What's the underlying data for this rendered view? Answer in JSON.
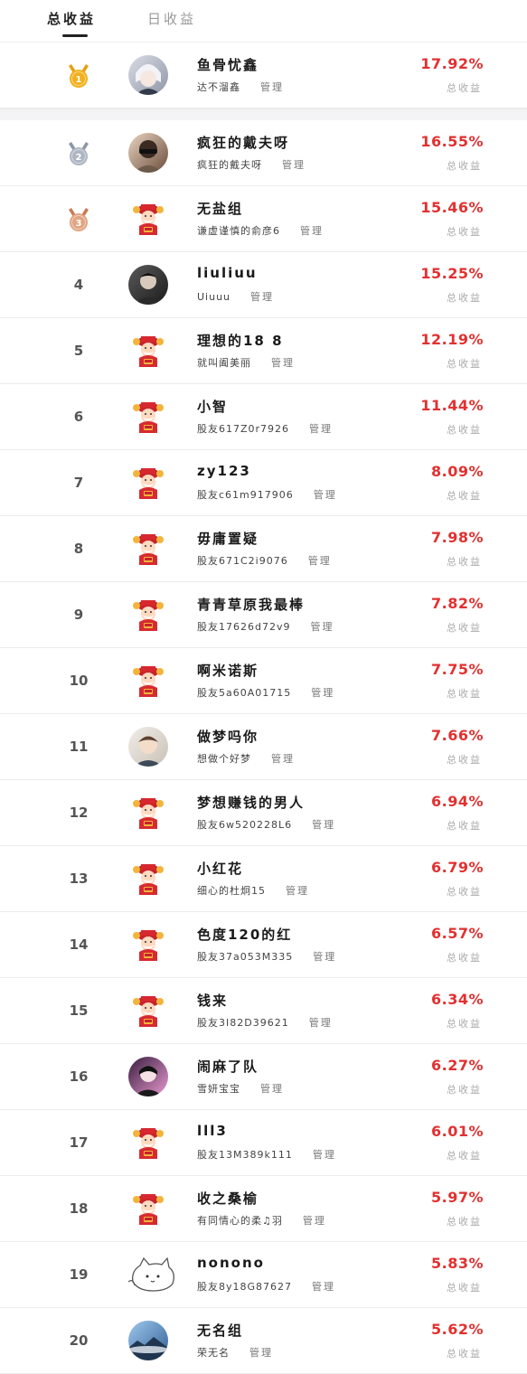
{
  "tabs": {
    "total": "总收益",
    "daily": "日收益"
  },
  "colors": {
    "accent": "#e33030",
    "gold": "#f2b01e",
    "silver": "#aeb6c2",
    "bronze": "#e0a583"
  },
  "manage_label": "管理",
  "pct_label": "总收益",
  "rows": [
    {
      "rank": "1",
      "medal": "gold",
      "name": "鱼骨忧鑫",
      "sub": "达不溜鑫",
      "pct": "17.92%",
      "avatar": "anime-white-hair"
    },
    {
      "rank": "2",
      "medal": "silver",
      "name": "疯狂的戴夫呀",
      "sub": "疯狂的戴夫呀",
      "pct": "16.55%",
      "avatar": "photo-brown"
    },
    {
      "rank": "3",
      "medal": "bronze",
      "name": "无盐组",
      "sub": "谦虚谨慎的俞彦6",
      "pct": "15.46%",
      "avatar": "fortune-god"
    },
    {
      "rank": "4",
      "medal": "",
      "name": "liuliuu",
      "sub": "Uiuuu",
      "pct": "15.25%",
      "avatar": "photo-dark"
    },
    {
      "rank": "5",
      "medal": "",
      "name": "理想的18 8",
      "sub": "就叫阖美丽",
      "pct": "12.19%",
      "avatar": "fortune-god"
    },
    {
      "rank": "6",
      "medal": "",
      "name": "小智",
      "sub": "股友617Z0r7926",
      "pct": "11.44%",
      "avatar": "fortune-god"
    },
    {
      "rank": "7",
      "medal": "",
      "name": "zy123",
      "sub": "股友c61m917906",
      "pct": "8.09%",
      "avatar": "fortune-god"
    },
    {
      "rank": "8",
      "medal": "",
      "name": "毋庸置疑",
      "sub": "股友671C2i9076",
      "pct": "7.98%",
      "avatar": "fortune-god"
    },
    {
      "rank": "9",
      "medal": "",
      "name": "青青草原我最棒",
      "sub": "股友17626d72v9",
      "pct": "7.82%",
      "avatar": "fortune-god"
    },
    {
      "rank": "10",
      "medal": "",
      "name": "啊米诺斯",
      "sub": "股友5a60A01715",
      "pct": "7.75%",
      "avatar": "fortune-god"
    },
    {
      "rank": "11",
      "medal": "",
      "name": "做梦吗你",
      "sub": "想做个好梦",
      "pct": "7.66%",
      "avatar": "photo-boy"
    },
    {
      "rank": "12",
      "medal": "",
      "name": "梦想赚钱的男人",
      "sub": "股友6w520228L6",
      "pct": "6.94%",
      "avatar": "fortune-god"
    },
    {
      "rank": "13",
      "medal": "",
      "name": "小红花",
      "sub": "细心的杜炯15",
      "pct": "6.79%",
      "avatar": "fortune-god"
    },
    {
      "rank": "14",
      "medal": "",
      "name": "色度120的红",
      "sub": "股友37a053M335",
      "pct": "6.57%",
      "avatar": "fortune-god"
    },
    {
      "rank": "15",
      "medal": "",
      "name": "钱来",
      "sub": "股友3I82D39621",
      "pct": "6.34%",
      "avatar": "fortune-god"
    },
    {
      "rank": "16",
      "medal": "",
      "name": "闹麻了队",
      "sub": "雪妍宝宝",
      "pct": "6.27%",
      "avatar": "photo-pink"
    },
    {
      "rank": "17",
      "medal": "",
      "name": "lll3",
      "sub": "股友13M389k111",
      "pct": "6.01%",
      "avatar": "fortune-god"
    },
    {
      "rank": "18",
      "medal": "",
      "name": "收之桑榆",
      "sub": "有同情心的柔♫羽",
      "pct": "5.97%",
      "avatar": "fortune-god"
    },
    {
      "rank": "19",
      "medal": "",
      "name": "nonono",
      "sub": "股友8y18G87627",
      "pct": "5.83%",
      "avatar": "cat-sketch"
    },
    {
      "rank": "20",
      "medal": "",
      "name": "无名组",
      "sub": "荣无名",
      "pct": "5.62%",
      "avatar": "photo-sky"
    }
  ]
}
